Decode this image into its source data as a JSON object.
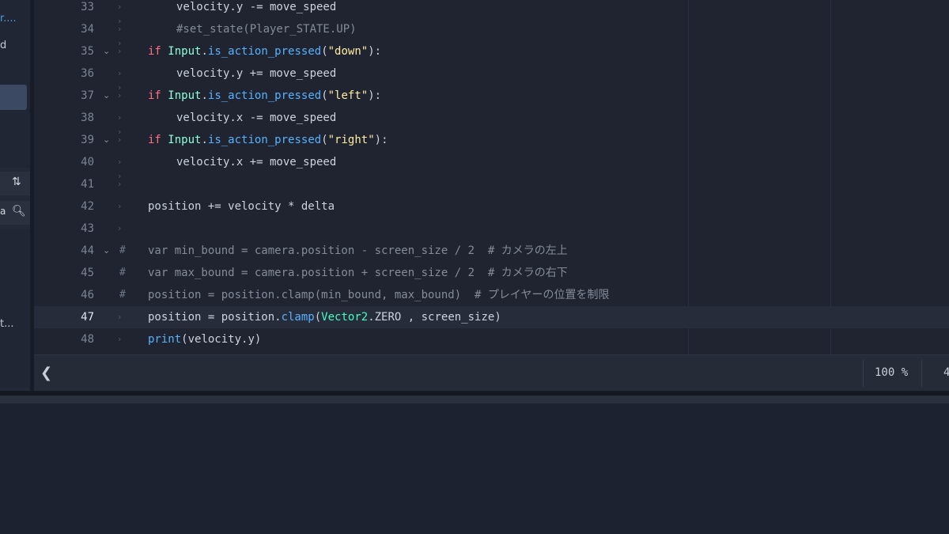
{
  "left_panel": {
    "texts": [
      "r....",
      "d",
      "t..."
    ],
    "icons": [
      "sort-icon",
      "search-icon"
    ]
  },
  "editor": {
    "lines": [
      {
        "n": "33",
        "fold": false,
        "hash": false,
        "indent": 2,
        "tokens": [
          [
            "velocity.y -= move_speed",
            ""
          ]
        ]
      },
      {
        "n": "34",
        "fold": false,
        "hash": false,
        "indent": 2,
        "tokens": [
          [
            "#set_state(Player_STATE.UP)",
            "cm"
          ]
        ]
      },
      {
        "n": "35",
        "fold": true,
        "hash": false,
        "indent": 1,
        "tokens": [
          [
            "if",
            "kw"
          ],
          [
            " ",
            ""
          ],
          [
            "Input",
            "ty"
          ],
          [
            ".",
            ""
          ],
          [
            "is_action_pressed",
            "fn"
          ],
          [
            "(",
            ""
          ],
          [
            "\"down\"",
            "st"
          ],
          [
            "):",
            ""
          ]
        ]
      },
      {
        "n": "36",
        "fold": false,
        "hash": false,
        "indent": 2,
        "tokens": [
          [
            "velocity.y += move_speed",
            ""
          ]
        ]
      },
      {
        "n": "37",
        "fold": true,
        "hash": false,
        "indent": 1,
        "tokens": [
          [
            "if",
            "kw"
          ],
          [
            " ",
            ""
          ],
          [
            "Input",
            "ty"
          ],
          [
            ".",
            ""
          ],
          [
            "is_action_pressed",
            "fn"
          ],
          [
            "(",
            ""
          ],
          [
            "\"left\"",
            "st"
          ],
          [
            "):",
            ""
          ]
        ]
      },
      {
        "n": "38",
        "fold": false,
        "hash": false,
        "indent": 2,
        "tokens": [
          [
            "velocity.x -= move_speed",
            ""
          ]
        ]
      },
      {
        "n": "39",
        "fold": true,
        "hash": false,
        "indent": 1,
        "tokens": [
          [
            "if",
            "kw"
          ],
          [
            " ",
            ""
          ],
          [
            "Input",
            "ty"
          ],
          [
            ".",
            ""
          ],
          [
            "is_action_pressed",
            "fn"
          ],
          [
            "(",
            ""
          ],
          [
            "\"right\"",
            "st"
          ],
          [
            "):",
            ""
          ]
        ]
      },
      {
        "n": "40",
        "fold": false,
        "hash": false,
        "indent": 2,
        "tokens": [
          [
            "velocity.x += move_speed",
            ""
          ]
        ]
      },
      {
        "n": "41",
        "fold": false,
        "hash": false,
        "indent": 1,
        "tokens": []
      },
      {
        "n": "42",
        "fold": false,
        "hash": false,
        "indent": 1,
        "tokens": [
          [
            "position += velocity * delta",
            ""
          ]
        ]
      },
      {
        "n": "43",
        "fold": false,
        "hash": false,
        "indent": 1,
        "tokens": []
      },
      {
        "n": "44",
        "fold": true,
        "hash": true,
        "indent": 1,
        "tokens": [
          [
            "var min_bound = camera.position - screen_size / 2  # カメラの左上",
            "cm"
          ]
        ]
      },
      {
        "n": "45",
        "fold": false,
        "hash": true,
        "indent": 1,
        "tokens": [
          [
            "var max_bound = camera.position + screen_size / 2  # カメラの右下",
            "cm"
          ]
        ]
      },
      {
        "n": "46",
        "fold": false,
        "hash": true,
        "indent": 1,
        "tokens": [
          [
            "position = position.clamp(min_bound, max_bound)  # プレイヤーの位置を制限",
            "cm"
          ]
        ]
      },
      {
        "n": "47",
        "fold": false,
        "hash": false,
        "indent": 1,
        "current": true,
        "tokens": [
          [
            "position = position.",
            ""
          ],
          [
            "clamp",
            "fn"
          ],
          [
            "(",
            ""
          ],
          [
            "Vector2",
            "cls"
          ],
          [
            ".ZERO , screen_size)",
            ""
          ]
        ]
      },
      {
        "n": "48",
        "fold": false,
        "hash": false,
        "indent": 1,
        "tokens": [
          [
            "print",
            "fn"
          ],
          [
            "(velocity.y)",
            ""
          ]
        ]
      }
    ]
  },
  "bottom_bar": {
    "scroll_left": "❮",
    "zoom": "100 %",
    "extra": "4"
  },
  "colors": {
    "keyword": "#ff7085",
    "type": "#8effda",
    "function": "#57b3ff",
    "string": "#ffeda1",
    "comment": "#858c98",
    "class": "#42ffc2"
  }
}
